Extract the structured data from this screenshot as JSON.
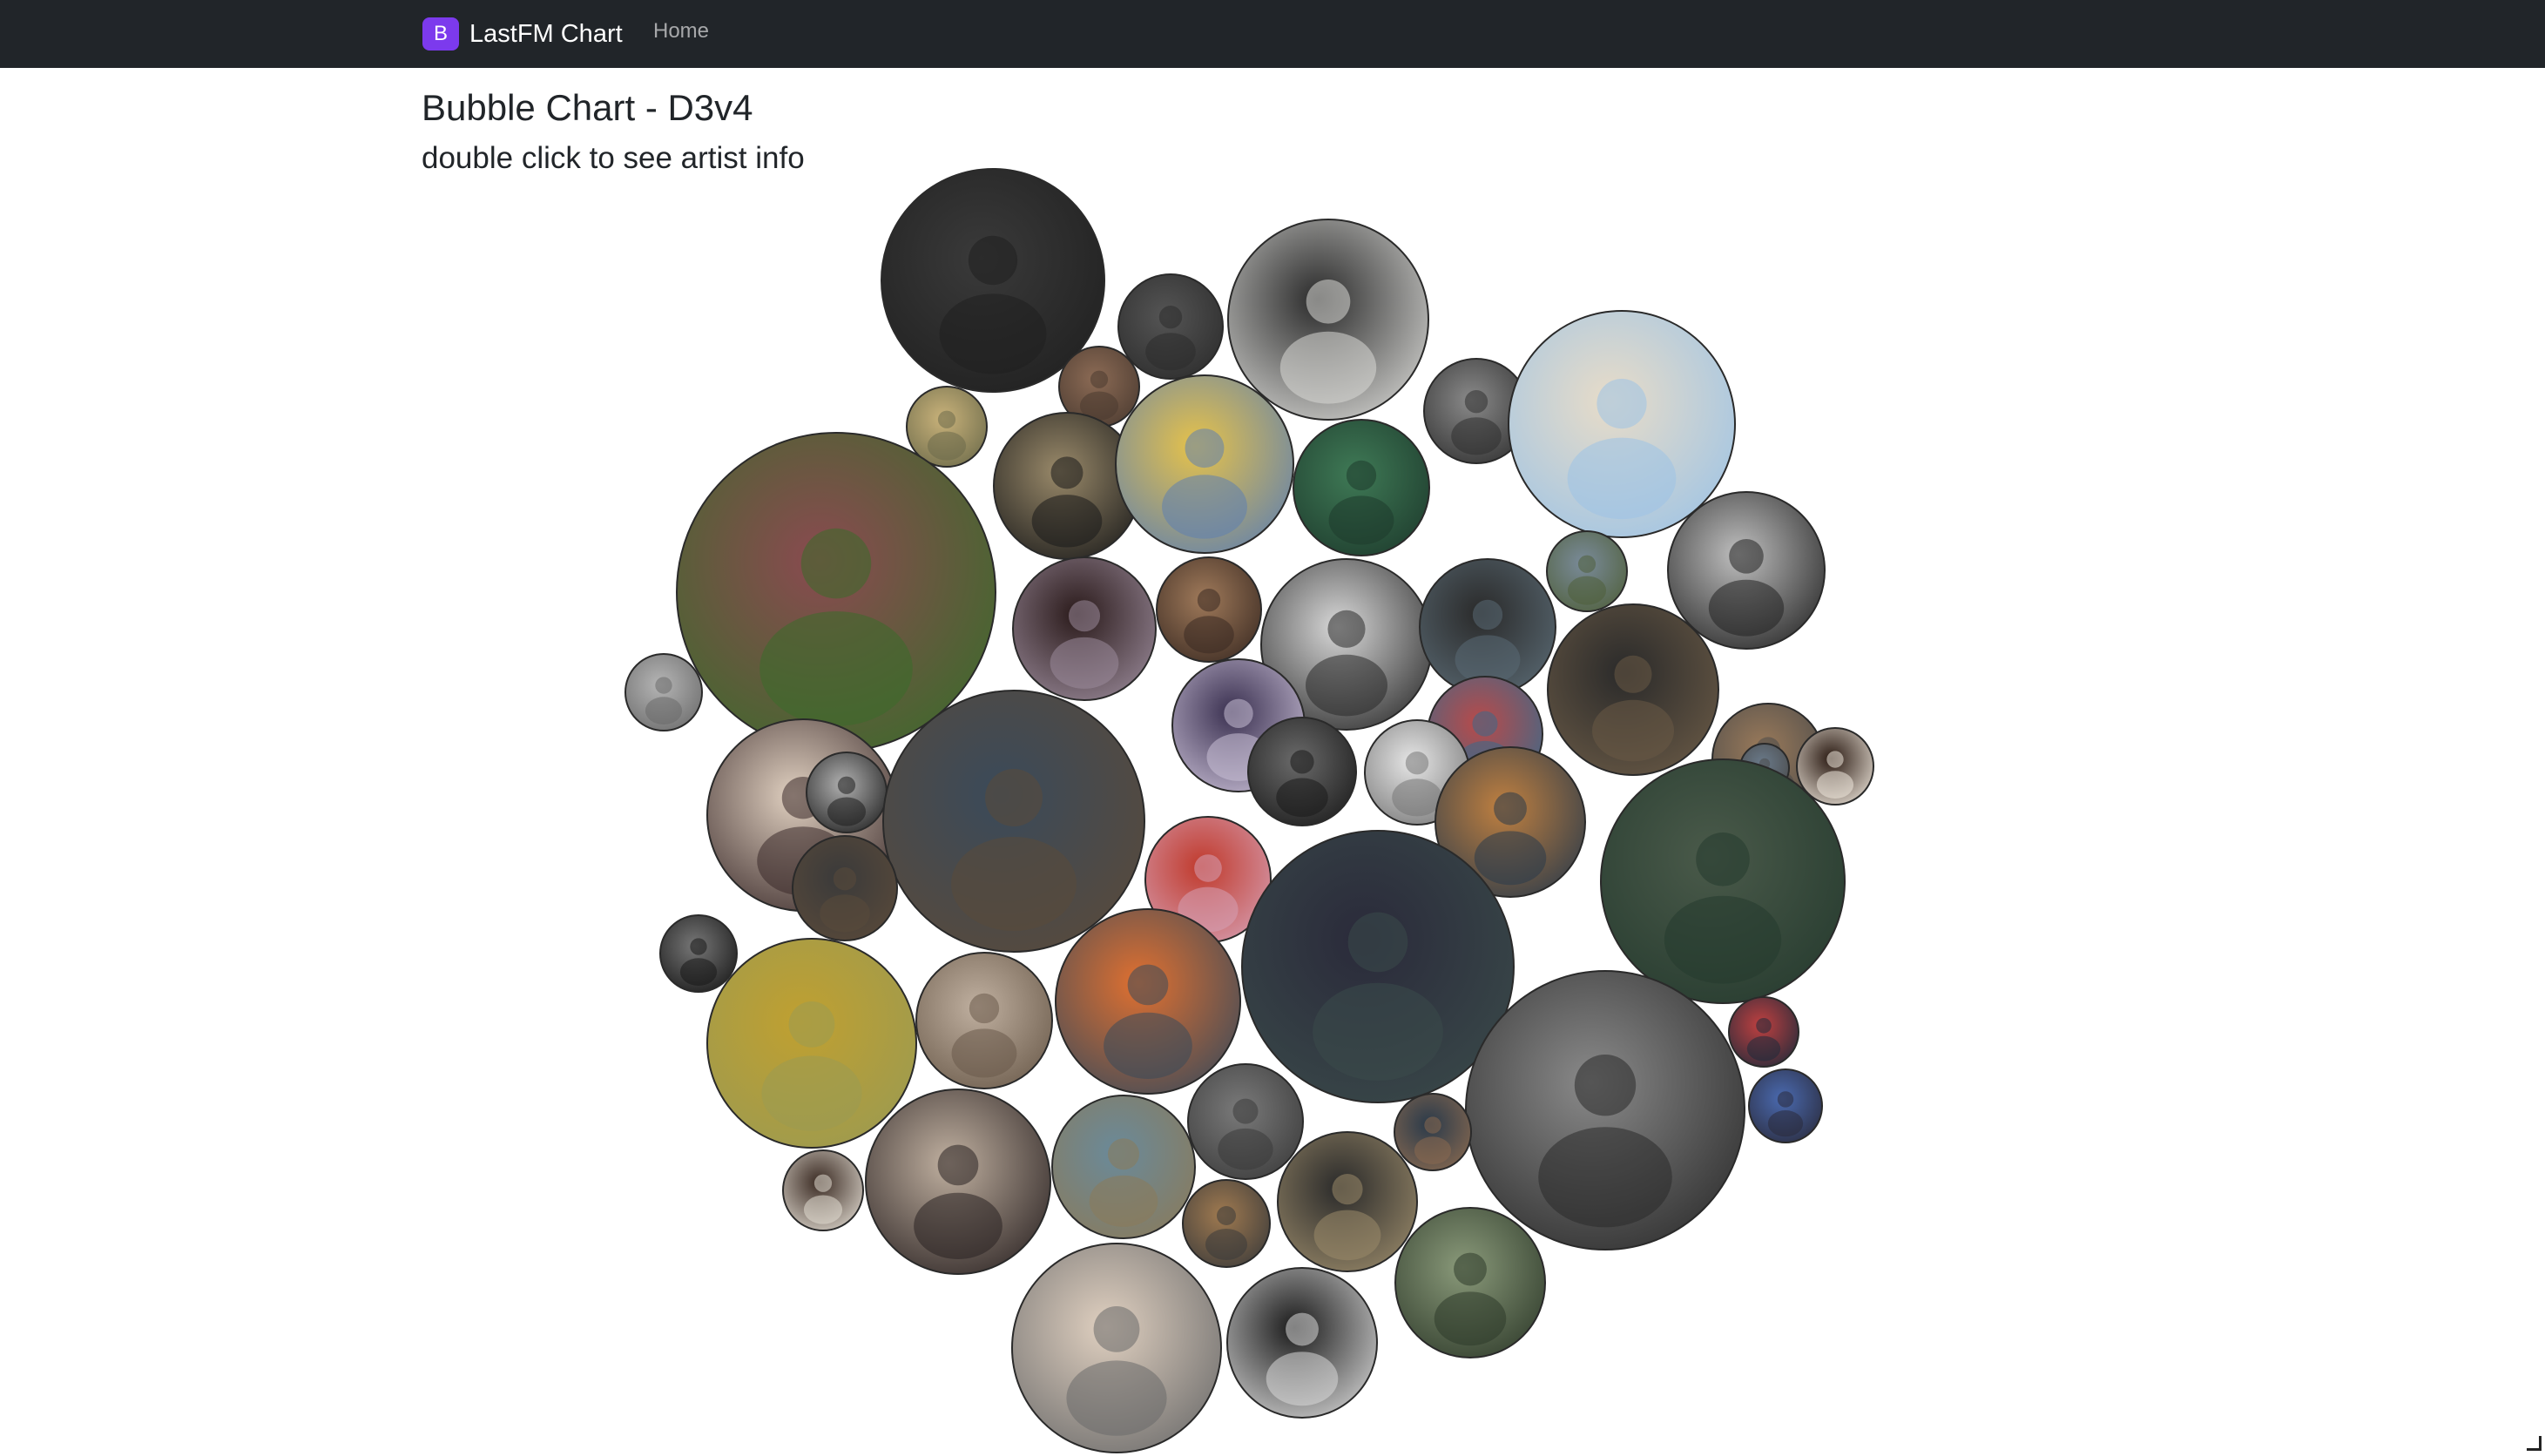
{
  "navbar": {
    "brand_logo_letter": "B",
    "brand_text": "LastFM Chart",
    "home_link": "Home",
    "logo_color": "#7c3aed",
    "background": "#212529"
  },
  "page": {
    "title": "Bubble Chart - D3v4",
    "subtitle": "double click to see artist info"
  },
  "bubbles": [
    {
      "tone": "#1f1f1f",
      "accent": "#3a3a3a"
    },
    {
      "tone": "#2b2b2b",
      "accent": "#555555"
    },
    {
      "tone": "#d9d9d6",
      "accent": "#2a2a2a"
    },
    {
      "tone": "#4a3a30",
      "accent": "#8c6b55"
    },
    {
      "tone": "#6b6a4a",
      "accent": "#c9b27a"
    },
    {
      "tone": "#1a1a1a",
      "accent": "#9a8a6a"
    },
    {
      "tone": "#5e7fb0",
      "accent": "#e6c24a"
    },
    {
      "tone": "#1d3a2c",
      "accent": "#3f7a56"
    },
    {
      "tone": "#2f2f2f",
      "accent": "#8a8a8a"
    },
    {
      "tone": "#9cc3e6",
      "accent": "#e8dcc8"
    },
    {
      "tone": "#3a6b2a",
      "accent": "#8a4a50"
    },
    {
      "tone": "#9a8a9a",
      "accent": "#2a1a1a"
    },
    {
      "tone": "#3a2a22",
      "accent": "#a07a5a"
    },
    {
      "tone": "#2a2a2a",
      "accent": "#d8d8d8"
    },
    {
      "tone": "#5a6a74",
      "accent": "#2a2a2a"
    },
    {
      "tone": "#4f5f3a",
      "accent": "#7a8b9a"
    },
    {
      "tone": "#232323",
      "accent": "#bfbfbf"
    },
    {
      "tone": "#6a6a6a",
      "accent": "#b5b5b5"
    },
    {
      "tone": "#c9bfd6",
      "accent": "#3a3050"
    },
    {
      "tone": "#3a6a8a",
      "accent": "#b84a4a"
    },
    {
      "tone": "#6a5a46",
      "accent": "#2a2a2a"
    },
    {
      "tone": "#4a4a4a",
      "accent": "#9a7a5a"
    },
    {
      "tone": "#3a2a2a",
      "accent": "#e0d0c0"
    },
    {
      "tone": "#1e1e1e",
      "accent": "#b0b0b0"
    },
    {
      "tone": "#5a4a3a",
      "accent": "#3a4a5a"
    },
    {
      "tone": "#1a1a1a",
      "accent": "#6a6a6a"
    },
    {
      "tone": "#767676",
      "accent": "#e6e6e6"
    },
    {
      "tone": "#2a3a4a",
      "accent": "#c08040"
    },
    {
      "tone": "#4a4a4a",
      "accent": "#6a7a8a"
    },
    {
      "tone": "#efe7dc",
      "accent": "#2a1a12"
    },
    {
      "tone": "#253a2e",
      "accent": "#4a5a4a"
    },
    {
      "tone": "#d6a0b4",
      "accent": "#c0392b"
    },
    {
      "tone": "#5a4a3a",
      "accent": "#3a3a3a"
    },
    {
      "tone": "#171717",
      "accent": "#777777"
    },
    {
      "tone": "#9a9a52",
      "accent": "#c0a030"
    },
    {
      "tone": "#6a5a4a",
      "accent": "#c0b0a0"
    },
    {
      "tone": "#3a4a5a",
      "accent": "#e07030"
    },
    {
      "tone": "#3a4a4a",
      "accent": "#2a2a3a"
    },
    {
      "tone": "#2a2a2a",
      "accent": "#8a8a8a"
    },
    {
      "tone": "#1e2a3a",
      "accent": "#c04040"
    },
    {
      "tone": "#2a2a3a",
      "accent": "#4a6ab0"
    },
    {
      "tone": "#3a3a3a",
      "accent": "#7a7a7a"
    },
    {
      "tone": "#8a6a50",
      "accent": "#2a3a4a"
    },
    {
      "tone": "#e2dcd2",
      "accent": "#3a2a22"
    },
    {
      "tone": "#2a2222",
      "accent": "#c0b0a0"
    },
    {
      "tone": "#8a7a5a",
      "accent": "#6a8a9a"
    },
    {
      "tone": "#3a3a3a",
      "accent": "#a07a50"
    },
    {
      "tone": "#9a8a6a",
      "accent": "#2a2a2a"
    },
    {
      "tone": "#2e3a2a",
      "accent": "#8a9a7a"
    },
    {
      "tone": "#6a6a6a",
      "accent": "#e0d0c0"
    },
    {
      "tone": "#d8d8d8",
      "accent": "#1a1a1a"
    }
  ]
}
